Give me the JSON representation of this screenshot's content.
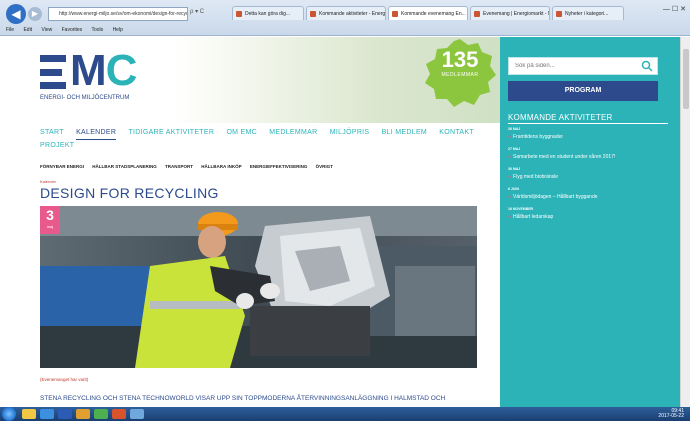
{
  "browser": {
    "address": "http://www.energi-miljo.se/sv/om-ekonomi/design-for-recycling/",
    "address_icons": "ρ ▾ C",
    "tabs": [
      {
        "label": "Detta kan göra dig..."
      },
      {
        "label": "Kommande aktiviteter - Energi..."
      },
      {
        "label": "Kommande evenemang En..."
      },
      {
        "label": "Evenemang | Energiomarkt - Nyhe..."
      },
      {
        "label": "Nyheter i kategori..."
      }
    ],
    "window_controls": "— ☐ ✕",
    "menu": [
      "File",
      "Edit",
      "View",
      "Favorites",
      "Tools",
      "Help"
    ]
  },
  "logo": {
    "m": "M",
    "c": "C",
    "subtitle": "ENERGI- OCH MILJÖCENTRUM"
  },
  "members": {
    "count": "135",
    "label": "MEDLEMMAR"
  },
  "nav": {
    "items": [
      "START",
      "KALENDER",
      "TIDIGARE AKTIVITETER",
      "OM EMC",
      "MEDLEMMAR",
      "MILJÖPRIS",
      "BLI MEDLEM",
      "KONTAKT",
      "PROJEKT"
    ],
    "active_index": 1
  },
  "subnav": {
    "items": [
      "FÖRNYBAR ENERGI",
      "HÅLLBAR STADSPLANERING",
      "TRANSPORT",
      "HÅLLBARA INKÖP",
      "ENERGIEFFEKTIVISERING",
      "ÖVRIGT"
    ]
  },
  "article": {
    "crumb": "Kalender",
    "title": "DESIGN FOR RECYCLING",
    "date_day": "3",
    "date_month": "maj",
    "caption": "(Evenemanget har varit)",
    "lead": "STENA RECYCLING OCH STENA TECHNOWORLD VISAR UPP SIN TOPPMODERNA ÅTERVINNINGSANLÄGGNING I HALMSTAD OCH"
  },
  "sidebar": {
    "search_placeholder": "Sök på siden...",
    "program_label": "PROGRAM",
    "activities_title": "KOMMANDE AKTIVITETER",
    "activities": [
      {
        "date": "26 MAJ",
        "label": "Framtidens byggnader"
      },
      {
        "date": "27 MAJ",
        "label": "Samarbete med en student under våren 2017!"
      },
      {
        "date": "30 MAJ",
        "label": "Flyg med biobränsle"
      },
      {
        "date": "6 JUNI",
        "label": "Världsmiljödagen – Hållbart byggande"
      },
      {
        "date": "16 NOVEMBER",
        "label": "Hållbart ledarskap"
      }
    ]
  },
  "taskbar": {
    "time": "09:41",
    "date": "2017-05-22"
  },
  "colors": {
    "teal": "#2bb3b8",
    "navy": "#2c4a8c",
    "pink": "#e85a8c",
    "green_badge": "#8cc63f"
  },
  "icons": {
    "back": "back-arrow-icon",
    "forward": "forward-arrow-icon",
    "search": "search-icon",
    "start": "windows-start-icon"
  }
}
